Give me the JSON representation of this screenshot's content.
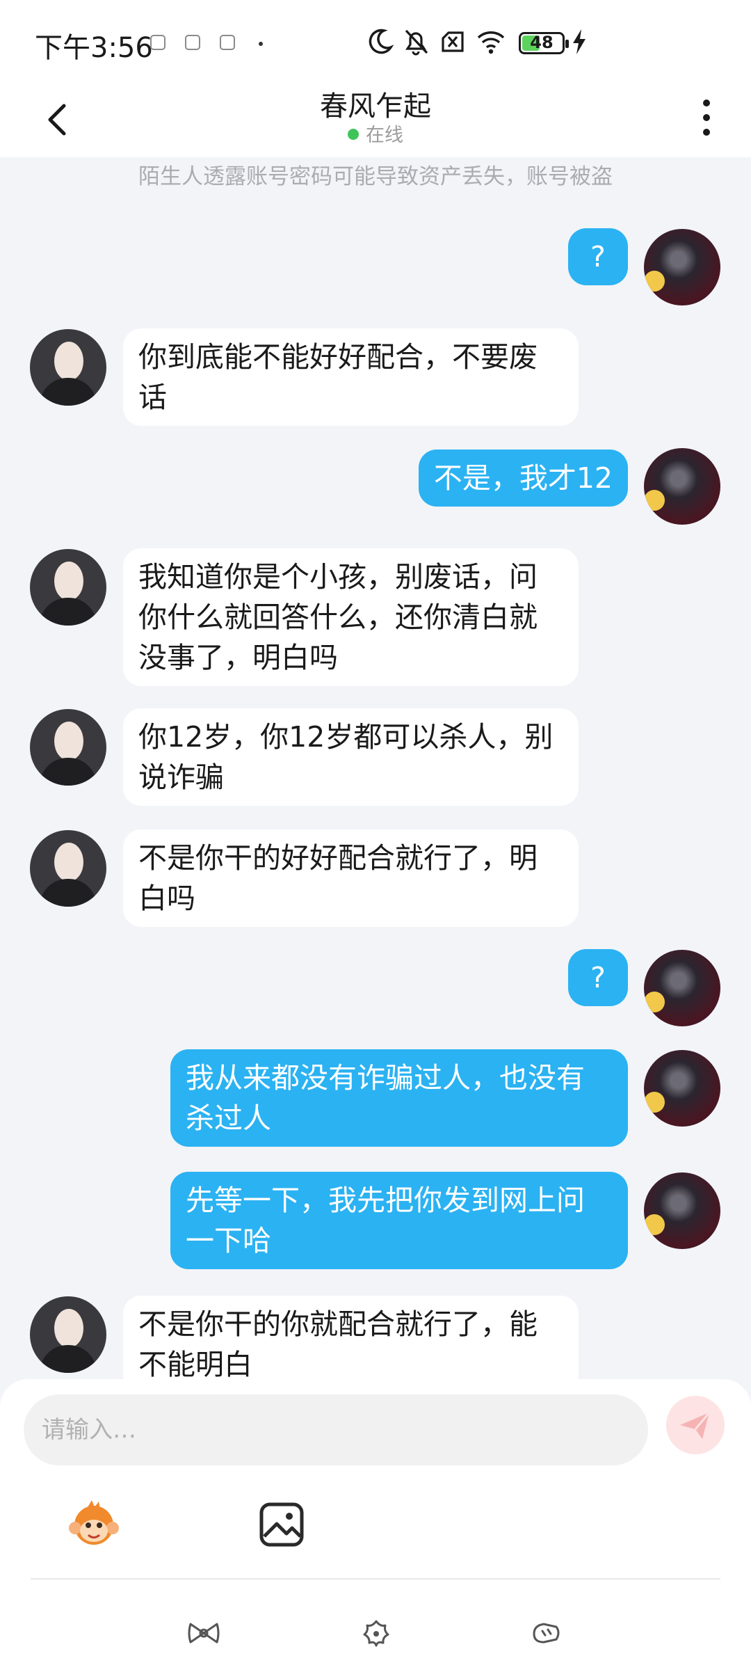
{
  "status_bar": {
    "time": "下午3:56",
    "battery_level": "48",
    "battery_color": "#5dd35d"
  },
  "header": {
    "title": "春风乍起",
    "status": "在线"
  },
  "notice": "陌生人透露账号密码可能导致资产丢失，账号被盗",
  "colors": {
    "outgoing_bubble": "#2bb2f2",
    "incoming_bubble": "#ffffff",
    "background": "#f2f4f8",
    "online_dot": "#3fc45a"
  },
  "messages": [
    {
      "side": "out",
      "text": "?"
    },
    {
      "side": "in",
      "text": "你到底能不能好好配合，不要废话"
    },
    {
      "side": "out",
      "text": "不是，我才12"
    },
    {
      "side": "in",
      "text": "我知道你是个小孩，别废话，问你什么就回答什么，还你清白就没事了，明白吗"
    },
    {
      "side": "in",
      "text": "你12岁，你12岁都可以杀人，别说诈骗"
    },
    {
      "side": "in",
      "text": "不是你干的好好配合就行了，明白吗"
    },
    {
      "side": "out",
      "text": "?"
    },
    {
      "side": "out",
      "text": "我从来都没有诈骗过人，也没有杀过人"
    },
    {
      "side": "out",
      "text": "先等一下，我先把你发到网上问一下哈"
    },
    {
      "side": "in",
      "text": "不是你干的你就配合就行了，能不能明白"
    }
  ],
  "composer": {
    "placeholder": "请输入…"
  },
  "icons": {
    "emoji": "monkey-emoji-icon",
    "image": "image-icon",
    "send": "send-icon",
    "nav": [
      "bow-icon",
      "flower-icon",
      "tag-icon"
    ]
  }
}
